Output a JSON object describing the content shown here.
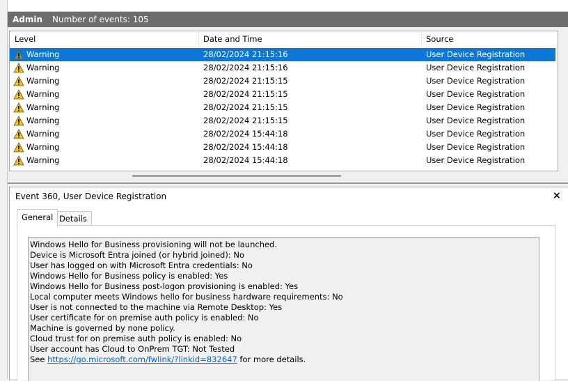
{
  "header": {
    "title": "Admin",
    "count_label": "Number of events: 105"
  },
  "columns": {
    "level": "Level",
    "date": "Date and Time",
    "source": "Source"
  },
  "events": [
    {
      "level": "Warning",
      "date": "28/02/2024 21:15:16",
      "source": "User Device Registration",
      "selected": true
    },
    {
      "level": "Warning",
      "date": "28/02/2024 21:15:16",
      "source": "User Device Registration"
    },
    {
      "level": "Warning",
      "date": "28/02/2024 21:15:15",
      "source": "User Device Registration"
    },
    {
      "level": "Warning",
      "date": "28/02/2024 21:15:15",
      "source": "User Device Registration"
    },
    {
      "level": "Warning",
      "date": "28/02/2024 21:15:15",
      "source": "User Device Registration"
    },
    {
      "level": "Warning",
      "date": "28/02/2024 21:15:15",
      "source": "User Device Registration"
    },
    {
      "level": "Warning",
      "date": "28/02/2024 15:44:18",
      "source": "User Device Registration"
    },
    {
      "level": "Warning",
      "date": "28/02/2024 15:44:18",
      "source": "User Device Registration"
    },
    {
      "level": "Warning",
      "date": "28/02/2024 15:44:18",
      "source": "User Device Registration"
    }
  ],
  "detail": {
    "title": "Event 360, User Device Registration",
    "close": "×",
    "tabs": {
      "general": "General",
      "details": "Details"
    },
    "message_lines": [
      "Windows Hello for Business provisioning will not be launched.",
      "Device is Microsoft Entra joined (or hybrid joined): No",
      "User has logged on with Microsoft Entra credentials: No",
      "Windows Hello for Business policy is enabled: Yes",
      "Windows Hello for Business post-logon provisioning is enabled: Yes",
      "Local computer meets Windows hello for business hardware requirements: No",
      "User is not connected to the machine via Remote Desktop: Yes",
      "User certificate for on premise auth policy is enabled: No",
      "Machine is governed by none policy.",
      "Cloud trust for on premise auth policy is enabled: No",
      "User account has Cloud to OnPrem TGT: Not Tested"
    ],
    "see_prefix": "See ",
    "link": "https://go.microsoft.com/fwlink/?linkid=832647",
    "see_suffix": " for more details."
  },
  "icons": {
    "warning": "warning-icon",
    "close": "close-icon"
  },
  "colors": {
    "selection": "#0b78d7",
    "title_bar": "#6d6d6d",
    "warning_fill": "#f5c400",
    "link": "#0066cc"
  }
}
